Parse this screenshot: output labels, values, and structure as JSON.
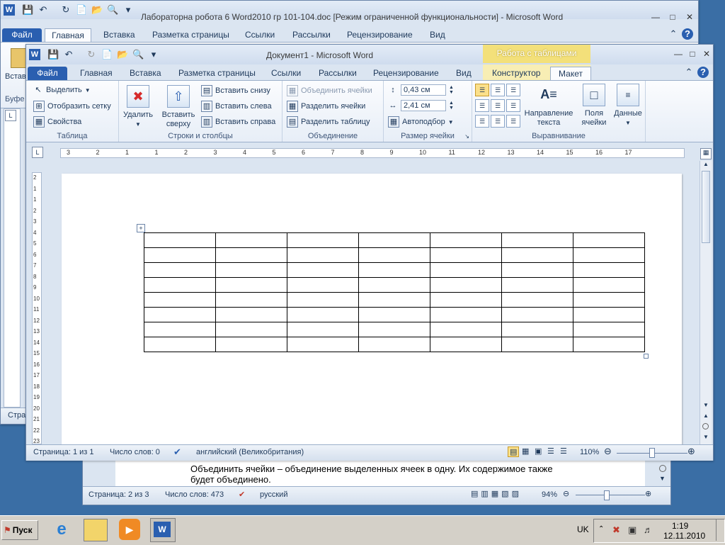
{
  "back_window": {
    "title": "Лабораторна робота 6 Word2010 гр 101-104.doc [Режим ограниченной функциональности]  -  Microsoft Word",
    "tabs": [
      "Файл",
      "Главная",
      "Вставка",
      "Разметка страницы",
      "Ссылки",
      "Рассылки",
      "Рецензирование",
      "Вид"
    ],
    "ribbon_left_label": "Встав",
    "ribbon_left_group": "Буфе",
    "status_left": "Стра",
    "doc_text_line1": "Объединить ячейки – объединение выделенных ячеек в одну. Их содержимое также",
    "doc_text_line2": "будет объединено.",
    "status": {
      "page": "Страница: 2 из 3",
      "words": "Число слов: 473",
      "lang": "русский",
      "zoom": "94%"
    }
  },
  "front_window": {
    "title": "Документ1  -  Microsoft Word",
    "context_tab_group": "Работа с таблицами",
    "tabs": {
      "file": "Файл",
      "home": "Главная",
      "insert": "Вставка",
      "layout": "Разметка страницы",
      "refs": "Ссылки",
      "mail": "Рассылки",
      "review": "Рецензирование",
      "view": "Вид",
      "design": "Конструктор",
      "tlayout": "Макет"
    },
    "ribbon": {
      "table": {
        "select": "Выделить",
        "gridlines": "Отобразить сетку",
        "properties": "Свойства",
        "label": "Таблица"
      },
      "rowscols": {
        "delete": "Удалить",
        "insert_above_1": "Вставить",
        "insert_above_2": "сверху",
        "insert_below": "Вставить снизу",
        "insert_left": "Вставить слева",
        "insert_right": "Вставить справа",
        "label": "Строки и столбцы"
      },
      "merge": {
        "merge_cells": "Объединить ячейки",
        "split_cells": "Разделить ячейки",
        "split_table": "Разделить таблицу",
        "label": "Объединение"
      },
      "cellsize": {
        "height": "0,43 см",
        "width": "2,41 см",
        "autofit": "Автоподбор",
        "label": "Размер ячейки"
      },
      "alignment": {
        "direction_1": "Направление",
        "direction_2": "текста",
        "margins_1": "Поля",
        "margins_2": "ячейки",
        "label": "Выравнивание"
      },
      "data": {
        "label": "Данные"
      }
    },
    "ruler_numbers": [
      "3",
      "2",
      "1",
      "1",
      "2",
      "3",
      "4",
      "5",
      "6",
      "7",
      "8",
      "9",
      "10",
      "11",
      "12",
      "13",
      "14",
      "15",
      "16",
      "17"
    ],
    "vruler_numbers": [
      "2",
      "1",
      "1",
      "2",
      "3",
      "4",
      "5",
      "6",
      "7",
      "8",
      "9",
      "10",
      "11",
      "12",
      "13",
      "14",
      "15",
      "16",
      "17",
      "18",
      "19",
      "20",
      "21",
      "22",
      "23"
    ],
    "table": {
      "rows": 8,
      "cols": 7
    },
    "status": {
      "page": "Страница: 1 из 1",
      "words": "Число слов: 0",
      "lang": "английский (Великобритания)",
      "zoom": "110%"
    }
  },
  "taskbar": {
    "start": "Пуск",
    "lang": "UK",
    "time": "1:19",
    "date": "12.11.2010"
  },
  "colors": {
    "desktop": "#3a6ea5",
    "file_tab": "#2a5fb0",
    "context_tab": "#f3e07a"
  }
}
